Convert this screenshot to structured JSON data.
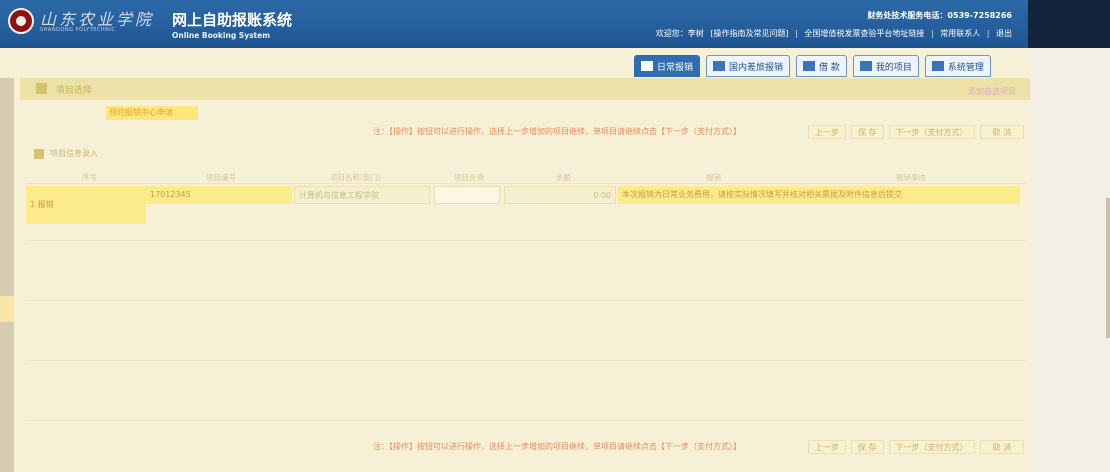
{
  "header": {
    "logo_script": "山东农业学院",
    "logo_subtitle": "SHANDONG POLYTECHNIC",
    "title": "网上自助报账系统",
    "subtitle": "Online Booking System",
    "hotline": "财务处技术服务电话：0539-7258266",
    "links": [
      "欢迎您：李树",
      "[操作指南及常见问题]",
      "全国增值税发票查验平台地址链接",
      "常用联系人",
      "退出"
    ]
  },
  "nav": {
    "tabs": [
      {
        "label": "日常报销",
        "active": true
      },
      {
        "label": "国内差旅报销",
        "active": false
      },
      {
        "label": "借 款",
        "active": false
      },
      {
        "label": "我的项目",
        "active": false
      },
      {
        "label": "系统管理",
        "active": false
      }
    ]
  },
  "toolbar": {
    "section_label": "项目选择",
    "right_link": "添加自选项目",
    "yellow_tag": "预约报销中心申请"
  },
  "notice": {
    "text": "注：【操作】按钮可以进行操作，选择上一步增加的项目继续，单项目请继续点击【下一步（支付方式）】"
  },
  "pager": {
    "buttons": [
      "上一步",
      "保 存",
      "下一步（支付方式）",
      "取 消"
    ]
  },
  "grid": {
    "section_title": "项目信息录入",
    "columns": [
      "序号",
      "项目编号",
      "项目名称(部门)",
      "项目负责",
      "余额",
      "报销",
      "报销事由"
    ],
    "row": {
      "left_cell": "1 报销",
      "project": "17012345",
      "name": "计算机与信息工程学院",
      "amount": "0.00",
      "remark": "本次报销为日常业务费用，请按实际情况填写并核对相关票据及附件信息后提交"
    }
  },
  "colors": {
    "header_blue": "#2d6aa8",
    "tab_active": "#2f6db1",
    "notice_orange": "#e48b5f",
    "highlight_yellow": "#fbeb8a"
  }
}
